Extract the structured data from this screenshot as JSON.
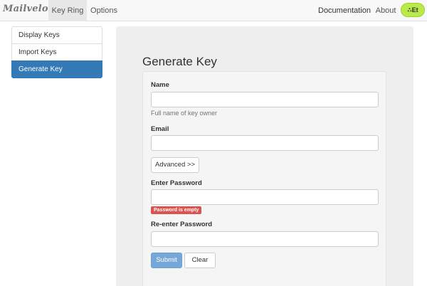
{
  "navbar": {
    "brand": "Mailvelope",
    "tabs": [
      {
        "label": "Key Ring",
        "active": true
      },
      {
        "label": "Options",
        "active": false
      }
    ],
    "right_links": {
      "documentation": "Documentation",
      "about": "About"
    },
    "extension_badge": "∴Et"
  },
  "sidebar": {
    "items": [
      {
        "label": "Display Keys",
        "active": false
      },
      {
        "label": "Import Keys",
        "active": false
      },
      {
        "label": "Generate Key",
        "active": true
      }
    ]
  },
  "main": {
    "title": "Generate Key",
    "form": {
      "name": {
        "label": "Name",
        "value": "",
        "help": "Full name of key owner"
      },
      "email": {
        "label": "Email",
        "value": ""
      },
      "advanced_button": "Advanced >>",
      "password": {
        "label": "Enter Password",
        "value": "",
        "error": "Password is empty"
      },
      "password_confirm": {
        "label": "Re-enter Password",
        "value": ""
      },
      "submit_button": "Submit",
      "clear_button": "Clear"
    }
  },
  "colors": {
    "active_blue": "#337ab7",
    "submit_blue": "#75a8d8",
    "error_red": "#d9534f",
    "badge_green": "#b9ea4a"
  }
}
